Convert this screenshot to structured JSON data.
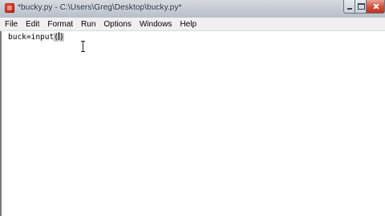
{
  "window": {
    "title": "*bucky.py - C:\\Users\\Greg\\Desktop\\bucky.py*"
  },
  "menu": {
    "items": [
      "File",
      "Edit",
      "Format",
      "Run",
      "Options",
      "Windows",
      "Help"
    ]
  },
  "editor": {
    "code_before_cursor": "buck=input",
    "code_open_paren": "(",
    "code_close_paren": ")"
  },
  "icons": {
    "app": "python-idle-icon",
    "minimize": "minimize-icon",
    "maximize": "maximize-icon",
    "close": "close-icon",
    "pointer": "i-beam-cursor-icon"
  },
  "colors": {
    "titlebar": "#c4cad1",
    "menubar": "#f0f0f0",
    "editor_bg": "#ffffff",
    "close_button": "#c0301c",
    "paren_highlight": "#c8c8c8"
  }
}
